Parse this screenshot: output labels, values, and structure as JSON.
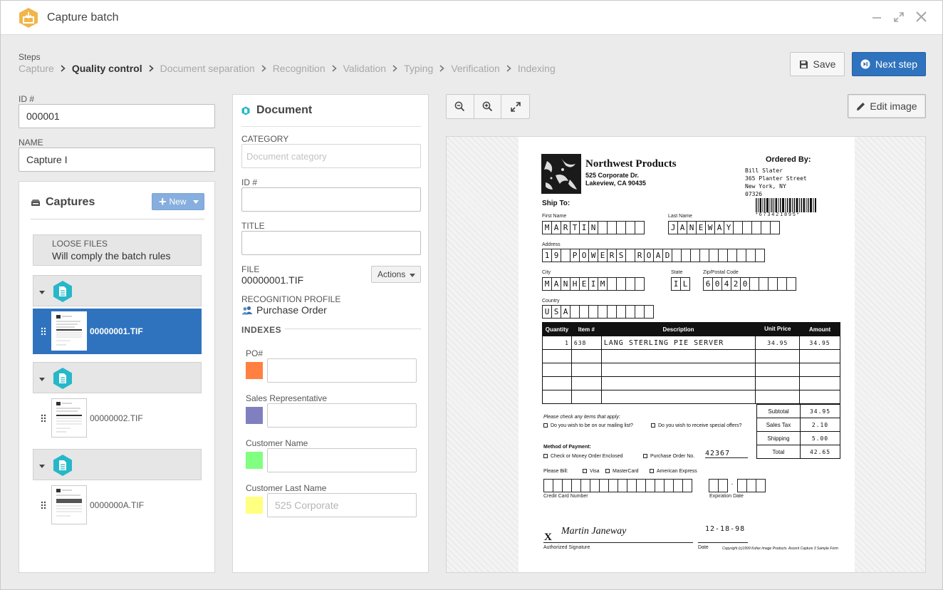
{
  "window": {
    "title": "Capture batch"
  },
  "steps": {
    "label": "Steps",
    "items": [
      "Capture",
      "Quality control",
      "Document separation",
      "Recognition",
      "Validation",
      "Typing",
      "Verification",
      "Indexing"
    ],
    "active_index": 1
  },
  "toolbar": {
    "save_label": "Save",
    "next_label": "Next step"
  },
  "batch": {
    "id_label": "ID #",
    "id_value": "000001",
    "name_label": "NAME",
    "name_value": "Capture I"
  },
  "captures": {
    "title": "Captures",
    "new_label": "New",
    "loose_files": {
      "title": "LOOSE FILES",
      "subtitle": "Will comply the batch rules"
    },
    "files": [
      "00000001.TIF",
      "00000002.TIF",
      "0000000A.TIF"
    ],
    "selected_file": "00000001.TIF"
  },
  "document": {
    "title": "Document",
    "category_label": "CATEGORY",
    "category_placeholder": "Document category",
    "id_label": "ID #",
    "title_label": "TITLE",
    "file_label": "FILE",
    "file_value": "00000001.TIF",
    "actions_label": "Actions",
    "profile_label": "RECOGNITION PROFILE",
    "profile_value": "Purchase Order",
    "indexes_label": "INDEXES",
    "indexes": [
      {
        "label": "PO#",
        "color": "#ff8040",
        "value": "",
        "placeholder": ""
      },
      {
        "label": "Sales Representative",
        "color": "#8080c0",
        "value": "",
        "placeholder": ""
      },
      {
        "label": "Customer Name",
        "color": "#80ff80",
        "value": "",
        "placeholder": ""
      },
      {
        "label": "Customer Last Name",
        "color": "#ffff80",
        "value": "",
        "placeholder": "525 Corporate"
      }
    ]
  },
  "viewer": {
    "edit_label": "Edit image",
    "form": {
      "company": "Northwest Products",
      "company_addr1": "525 Corporate Dr.",
      "company_addr2": "Lakeview, CA  90435",
      "ordered_by_label": "Ordered By:",
      "ordered_by": [
        "Bill Slater",
        "365 Planter Street",
        "New York, NY",
        "07326"
      ],
      "barcode_text": "*673421895*",
      "ship_to": "Ship To:",
      "first_name_label": "First Name",
      "first_name": "MARTIN",
      "last_name_label": "Last Name",
      "last_name": "JANEWAY",
      "address_label": "Address",
      "address": "19 POWERS ROAD",
      "city_label": "City",
      "city": "MANHEIM",
      "state_label": "State",
      "state": "IL",
      "zip_label": "Zip/Postal Code",
      "zip": "60420",
      "country_label": "Country",
      "country": "USA",
      "columns": [
        "Quantity",
        "Item #",
        "Description",
        "Unit Price",
        "Amount"
      ],
      "line_items": [
        {
          "qty": "1",
          "item": "638",
          "desc": "LANG STERLING PIE SERVER",
          "price": "34.95",
          "amount": "34.95"
        }
      ],
      "subtotal_label": "Subtotal",
      "subtotal": "34.95",
      "tax_label": "Sales Tax",
      "tax": "2.10",
      "shipping_label": "Shipping",
      "shipping": "5.00",
      "total_label": "Total",
      "total": "42.65",
      "check_items_label": "Please check any items that apply:",
      "mailing_list": "Do you wish to be on our mailing list?",
      "special_offers": "Do you wish to receive special offers?",
      "payment_label": "Method of Payment:",
      "pay_check": "Check or Money Order Enclosed",
      "pay_po": "Purchase Order No.",
      "po_number": "42367",
      "bill_label": "Please Bill:",
      "bill_visa": "Visa",
      "bill_mc": "MasterCard",
      "bill_amex": "American Express",
      "cc_label": "Credit Card Number",
      "exp_label": "Expiration Date",
      "signature": "Martin Janeway",
      "sign_x": "X",
      "date_written": "12-18-98",
      "auth_sig_label": "Authorized Signature",
      "date_label": "Date",
      "copyright": "Copyright (c)1999 Kofax Image Products. Ascent Capture 3 Sample Form"
    }
  }
}
